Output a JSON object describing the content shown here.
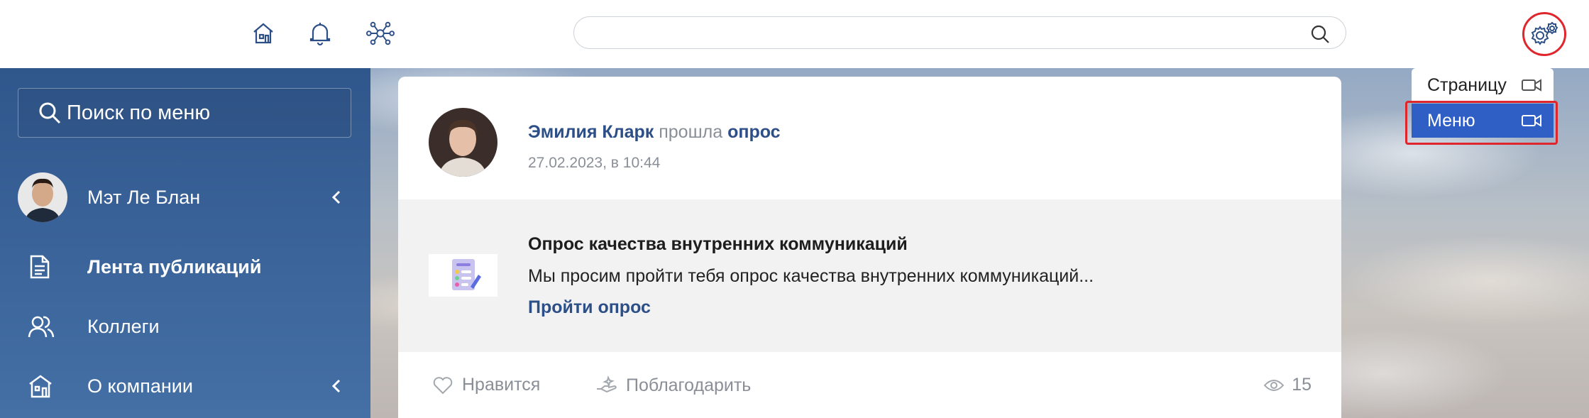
{
  "topbar": {
    "icons": [
      "home-icon",
      "bell-icon",
      "network-icon"
    ],
    "search_placeholder": "",
    "settings_icon": "gears-icon"
  },
  "sidebar": {
    "search_label": "Поиск по меню",
    "user_name": "Мэт Ле Блан",
    "items": [
      {
        "label": "Лента публикаций",
        "icon": "document-icon"
      },
      {
        "label": "Коллеги",
        "icon": "people-icon"
      },
      {
        "label": "О компании",
        "icon": "building-icon"
      }
    ]
  },
  "post": {
    "author": "Эмилия Кларк",
    "action": "прошла",
    "target": "опрос",
    "date": "27.02.2023, в 10:44",
    "poll": {
      "title": "Опрос качества внутренних коммуникаций",
      "description": "Мы просим пройти тебя опрос качества внутренних коммуникаций...",
      "link": "Пройти опрос"
    },
    "footer": {
      "like": "Нравится",
      "thank": "Поблагодарить",
      "views": "15"
    }
  },
  "dropdown": {
    "items": [
      {
        "label": "Страницу",
        "icon": "video-camera-icon"
      },
      {
        "label": "Меню",
        "icon": "video-camera-icon",
        "selected": true
      }
    ]
  },
  "colors": {
    "brand": "#2d4f88",
    "sidebar": "#3a6399",
    "selected": "#2f5fc4",
    "highlight": "#e0262d"
  }
}
